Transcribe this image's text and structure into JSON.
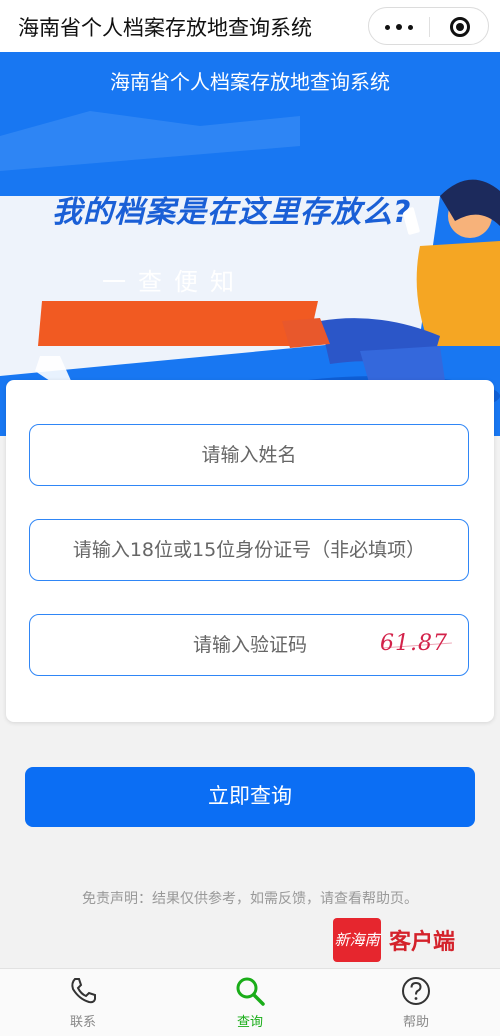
{
  "app": {
    "window_title": "海南省个人档案存放地查询系统"
  },
  "banner": {
    "subtitle": "海南省个人档案存放地查询系统",
    "headline": "我的档案是在这里存放么?",
    "tagline": "一查便知"
  },
  "form": {
    "name_placeholder": "请输入姓名",
    "id_placeholder": "请输入18位或15位身份证号（非必填项）",
    "captcha_placeholder": "请输入验证码",
    "captcha_code": "61.87"
  },
  "submit_label": "立即查询",
  "disclaimer": "免责声明：结果仅供参考，如需反馈，请查看帮助页。",
  "watermark": {
    "logo_text": "新海南",
    "text": "客户端"
  },
  "tabbar": {
    "items": [
      {
        "label": "联系",
        "icon": "phone-icon",
        "active": false
      },
      {
        "label": "查询",
        "icon": "search-icon",
        "active": true
      },
      {
        "label": "帮助",
        "icon": "help-icon",
        "active": false
      }
    ]
  },
  "colors": {
    "primary": "#1877f2",
    "button": "#0b6ef4",
    "accent_orange": "#f15a22",
    "active_tab": "#1aad19"
  }
}
